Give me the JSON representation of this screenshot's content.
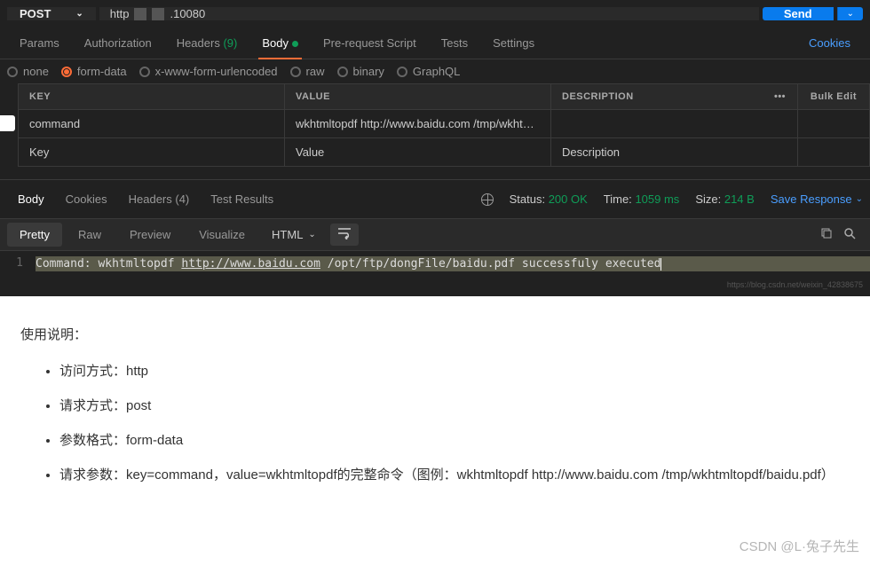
{
  "request": {
    "method": "POST",
    "url_prefix": "http",
    "url_suffix": ".10080",
    "send_label": "Send"
  },
  "tabs": {
    "params": "Params",
    "auth": "Authorization",
    "headers": "Headers",
    "headers_count": "(9)",
    "body": "Body",
    "prereq": "Pre-request Script",
    "tests": "Tests",
    "settings": "Settings",
    "cookies": "Cookies"
  },
  "body_opts": {
    "none": "none",
    "formdata": "form-data",
    "xwww": "x-www-form-urlencoded",
    "raw": "raw",
    "binary": "binary",
    "graphql": "GraphQL"
  },
  "kv": {
    "h_key": "KEY",
    "h_value": "VALUE",
    "h_desc": "DESCRIPTION",
    "bulk": "Bulk Edit",
    "rows": [
      {
        "key": "command",
        "value": "wkhtmltopdf http://www.baidu.com /tmp/wkhtmltop...",
        "desc": ""
      }
    ],
    "ph_key": "Key",
    "ph_value": "Value",
    "ph_desc": "Description"
  },
  "response": {
    "tabs": {
      "body": "Body",
      "cookies": "Cookies",
      "headers": "Headers",
      "headers_count": "(4)",
      "test": "Test Results"
    },
    "status_label": "Status:",
    "status_value": "200 OK",
    "time_label": "Time:",
    "time_value": "1059 ms",
    "size_label": "Size:",
    "size_value": "214 B",
    "save": "Save Response",
    "viewer": {
      "pretty": "Pretty",
      "raw": "Raw",
      "preview": "Preview",
      "visualize": "Visualize",
      "lang": "HTML"
    },
    "code": {
      "line_no": "1",
      "prefix": "Command: wkhtmltopdf ",
      "url": "http://www.baidu.com",
      "suffix": " /opt/ftp/dongFile/baidu.pdf successfuly executed"
    },
    "watermark": "https://blog.csdn.net/weixin_42838675"
  },
  "doc": {
    "title": "使用说明：",
    "items": [
      "访问方式：http",
      "请求方式：post",
      "参数格式：form-data",
      "请求参数：key=command，value=wkhtmltopdf的完整命令（图例：wkhtmltopdf http://www.baidu.com /tmp/wkhtmltopdf/baidu.pdf）"
    ]
  },
  "csdn_mark": "CSDN @L·兔子先生"
}
